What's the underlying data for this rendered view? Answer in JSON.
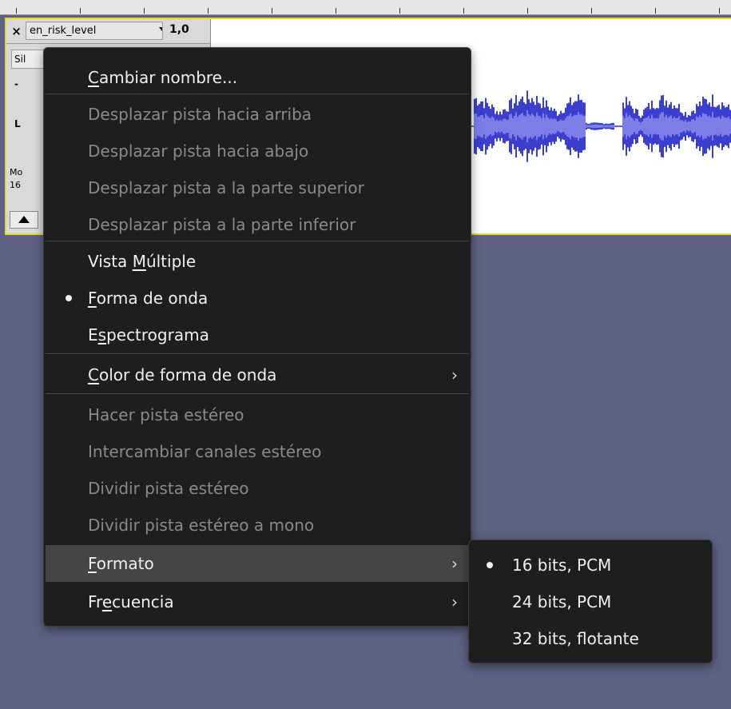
{
  "track": {
    "close_glyph": "×",
    "name": "en_risk_level",
    "rate": "1,0",
    "silence_label": "Sil",
    "gain_label": "-",
    "pan_label": "L",
    "info_line1": "Mo",
    "info_line2": "16"
  },
  "menu": {
    "items": [
      {
        "pre": "",
        "u": "C",
        "post": "ambiar nombre...",
        "enabled": true
      },
      {
        "pre": "Desplazar pista hacia arriba",
        "u": "",
        "post": "",
        "enabled": false
      },
      {
        "pre": "Desplazar pista hacia abajo",
        "u": "",
        "post": "",
        "enabled": false
      },
      {
        "pre": "Desplazar pista a la parte superior",
        "u": "",
        "post": "",
        "enabled": false
      },
      {
        "pre": "Desplazar pista a la parte inferior",
        "u": "",
        "post": "",
        "enabled": false
      },
      {
        "pre": "Vista ",
        "u": "M",
        "post": "últiple",
        "enabled": true
      },
      {
        "pre": "",
        "u": "F",
        "post": "orma de onda",
        "enabled": true,
        "checked": true
      },
      {
        "pre": "E",
        "u": "s",
        "post": "pectrograma",
        "enabled": true
      },
      {
        "pre": "",
        "u": "C",
        "post": "olor de forma de onda",
        "enabled": true,
        "submenu": true
      },
      {
        "pre": "Hacer pista estéreo",
        "u": "",
        "post": "",
        "enabled": false
      },
      {
        "pre": "Intercambiar canales estéreo",
        "u": "",
        "post": "",
        "enabled": false
      },
      {
        "pre": "Dividir pista estéreo",
        "u": "",
        "post": "",
        "enabled": false
      },
      {
        "pre": "Dividir pista estéreo a mono",
        "u": "",
        "post": "",
        "enabled": false
      },
      {
        "pre": "",
        "u": "F",
        "post": "ormato",
        "enabled": true,
        "submenu": true,
        "highlighted": true
      },
      {
        "pre": "Fr",
        "u": "e",
        "post": "cuencia",
        "enabled": true,
        "submenu": true
      }
    ],
    "chevron_glyph": "›"
  },
  "submenu": {
    "items": [
      {
        "label": "16 bits, PCM",
        "checked": true
      },
      {
        "label": "24 bits, PCM",
        "checked": false
      },
      {
        "label": "32 bits, flotante",
        "checked": false
      }
    ]
  },
  "colors": {
    "background": "#5e6182",
    "menu_bg": "#1e1e1e",
    "menu_highlight": "#454545",
    "waveform": "#3b3fd0",
    "waveform_rms": "#7a7ee6",
    "track_border": "#e8d83a"
  }
}
